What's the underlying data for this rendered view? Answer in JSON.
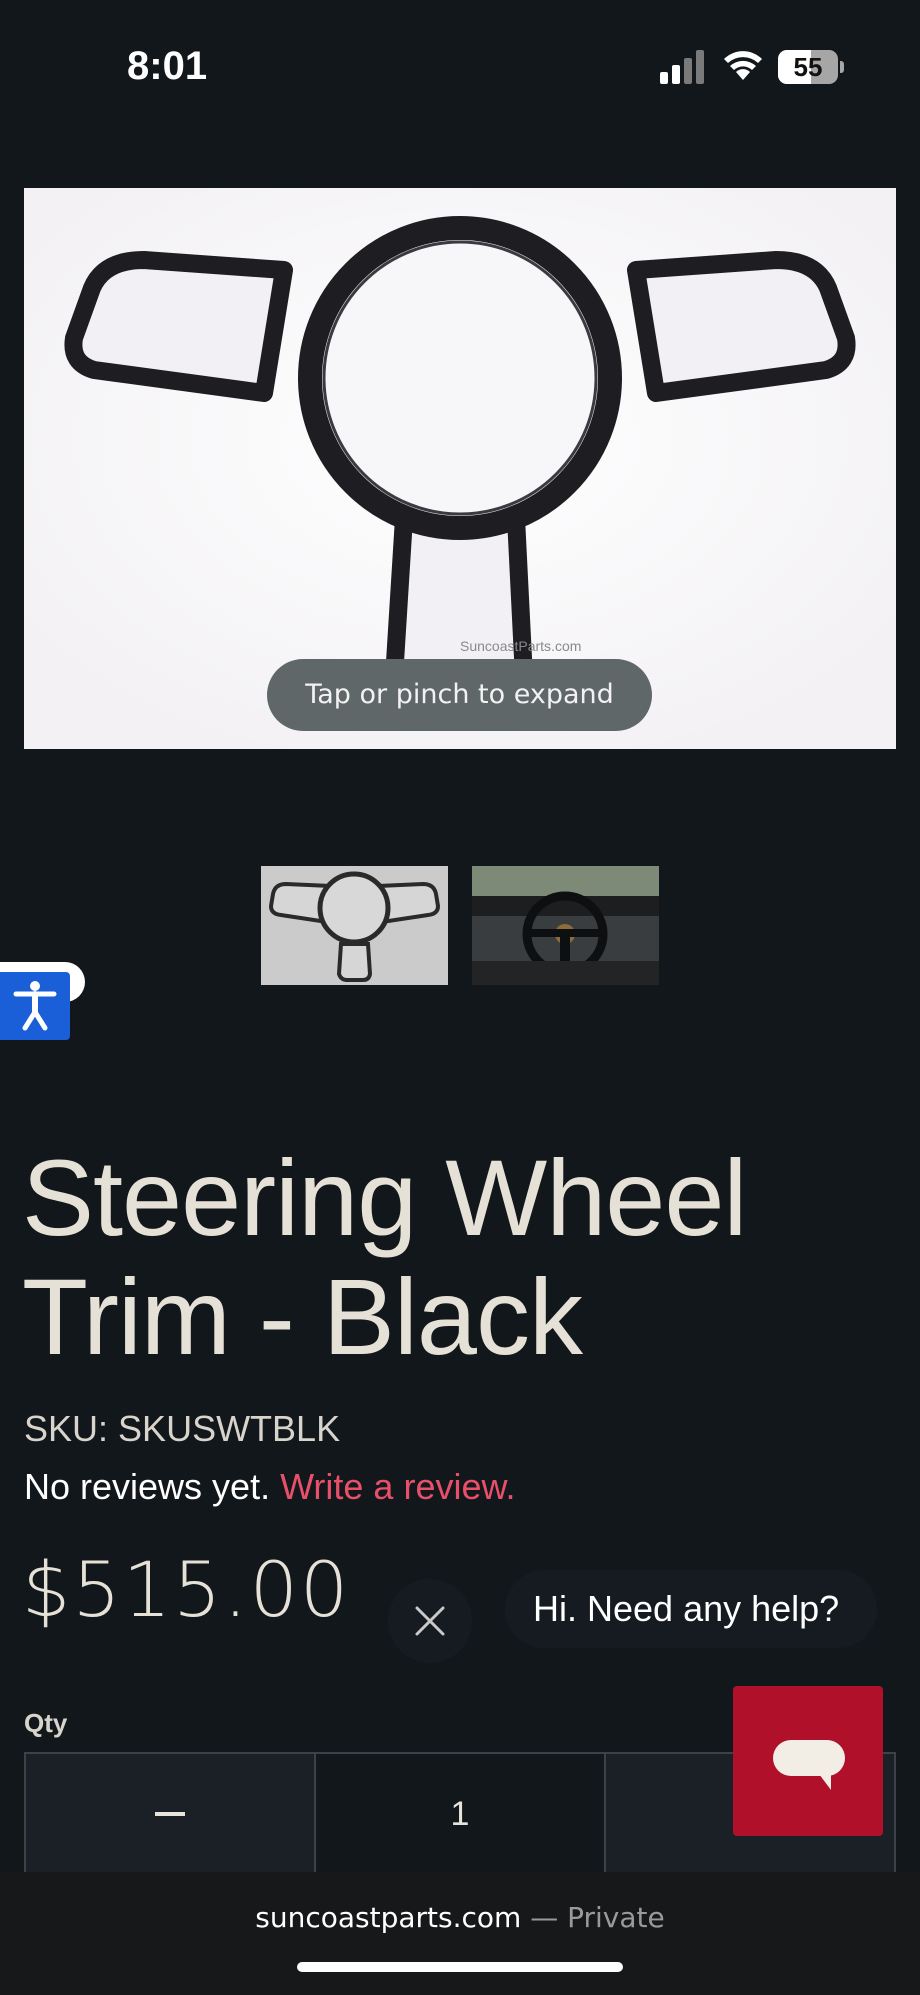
{
  "status_bar": {
    "time": "8:01",
    "battery": "55",
    "battery_level": 0.55,
    "icons": [
      "signal-icon",
      "wifi-icon",
      "battery-icon"
    ]
  },
  "gallery": {
    "watermark": "SuncoastParts.com",
    "expand_hint": "Tap or pinch to expand",
    "thumbnails": [
      "steering-wheel-trim",
      "car-interior"
    ]
  },
  "product": {
    "title": "Steering Wheel Trim - Black",
    "sku_label": "SKU:",
    "sku": "SKUSWTBLK",
    "reviews_text": "No reviews yet.",
    "review_link": "Write a review.",
    "price": "$515.00"
  },
  "chat": {
    "greeting": "Hi. Need any help?",
    "close_icon": "close-icon",
    "chat_icon": "chat-bubble-icon",
    "accent": "#b0102a"
  },
  "quantity": {
    "label": "Qty",
    "value": "1"
  },
  "browser": {
    "domain": "suncoastparts.com",
    "separator": " — ",
    "mode": "Private"
  },
  "colors": {
    "background": "#12171c",
    "link": "#e8506a",
    "accessibility": "#1a5fd8"
  }
}
